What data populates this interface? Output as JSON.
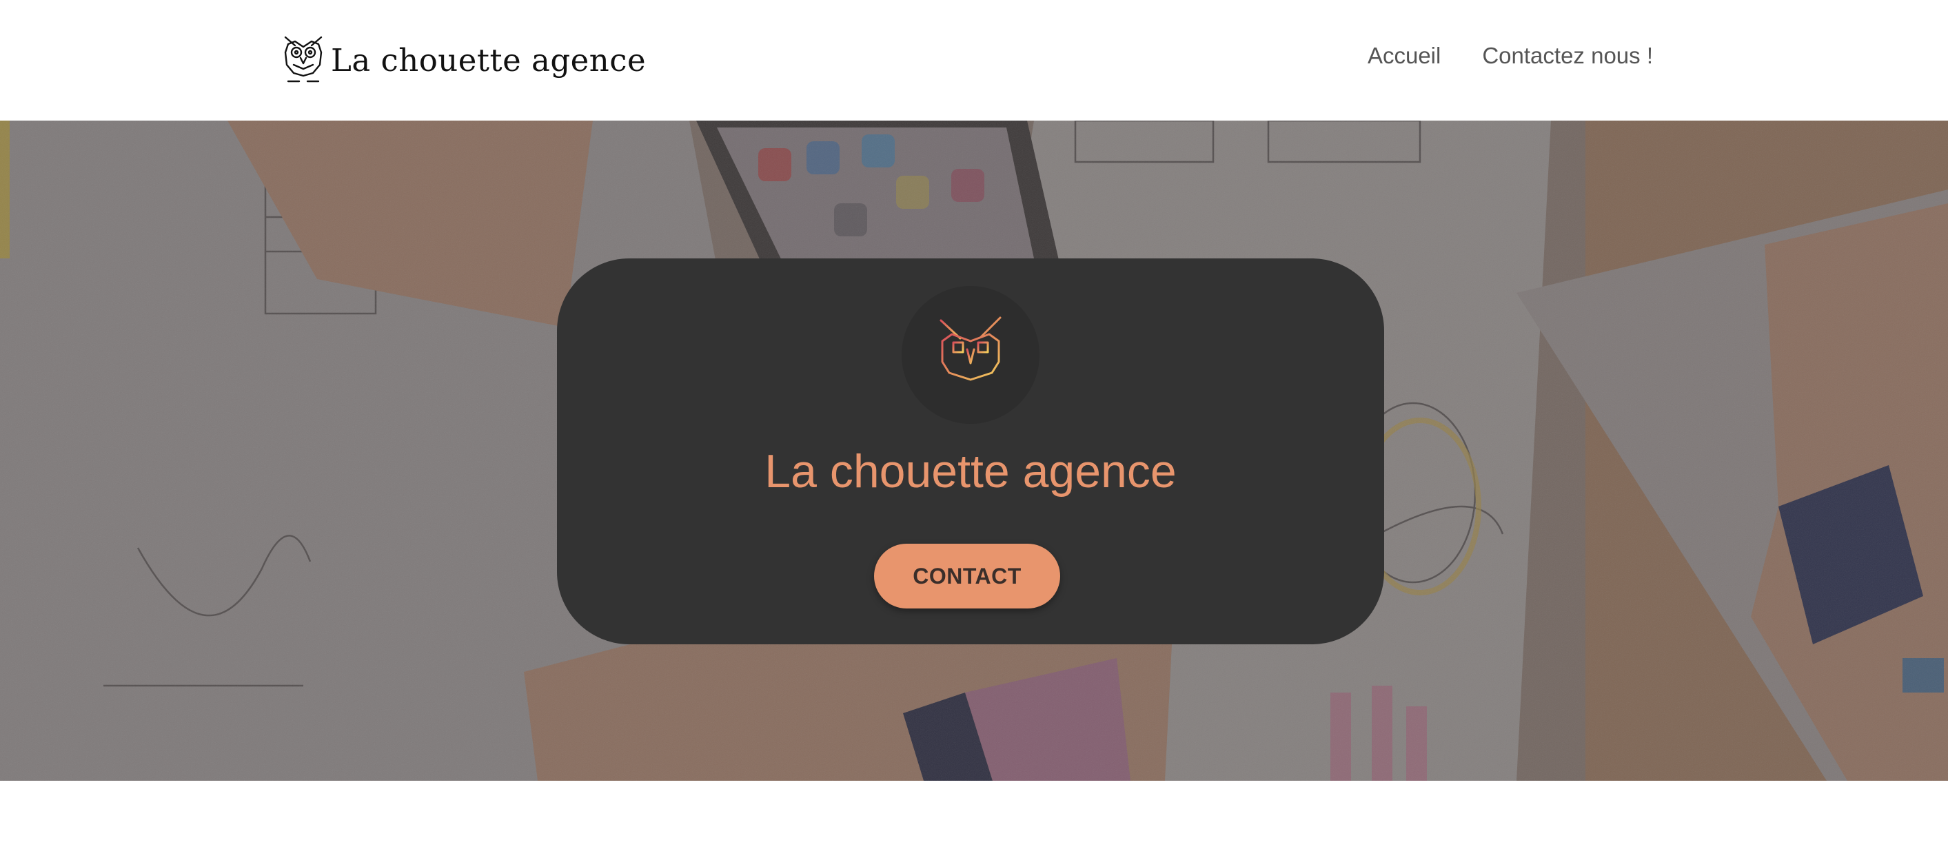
{
  "header": {
    "brand_text": "La chouette agence",
    "logo_icon": "owl-icon",
    "nav": [
      {
        "label": "Accueil"
      },
      {
        "label": "Contactez nous !"
      }
    ]
  },
  "hero": {
    "background_image": "desk-sketches-photo",
    "card": {
      "logo_icon": "owl-gradient-icon",
      "title": "La chouette agence",
      "button_label": "CONTACT"
    }
  },
  "colors": {
    "accent": "#e8956d",
    "card_background": "#333333",
    "nav_text": "#555555",
    "gradient_start": "#d9505a",
    "gradient_end": "#f2cd5c"
  }
}
